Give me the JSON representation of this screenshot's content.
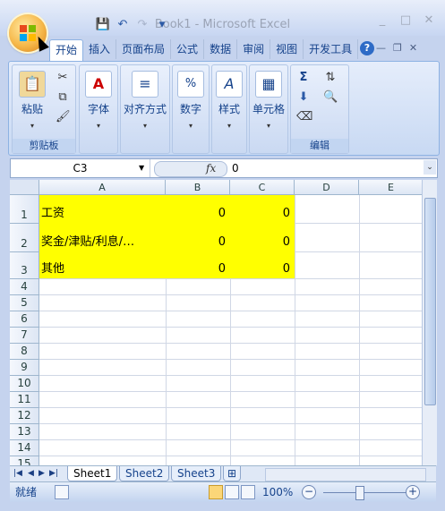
{
  "window": {
    "title": "Book1 - Microsoft Excel"
  },
  "qat": {
    "save": "💾",
    "undo": "↶",
    "redo": "↷",
    "more": "▾"
  },
  "ribbon": {
    "tabs": [
      "开始",
      "插入",
      "页面布局",
      "公式",
      "数据",
      "审阅",
      "视图",
      "开发工具"
    ],
    "groups": {
      "clipboard": {
        "paste": "粘贴",
        "label": "剪贴板"
      },
      "font": {
        "label": "字体"
      },
      "align": {
        "label": "对齐方式"
      },
      "number": {
        "label": "数字"
      },
      "styles": {
        "label": "样式"
      },
      "cells": {
        "label": "单元格"
      },
      "editing": {
        "label": "编辑"
      }
    }
  },
  "formula_bar": {
    "name_box": "C3",
    "fx": "fx",
    "value": "0"
  },
  "sheet": {
    "columns": [
      "A",
      "B",
      "C",
      "D",
      "E"
    ],
    "rows": [
      "1",
      "2",
      "3",
      "4",
      "5",
      "6",
      "7",
      "8",
      "9",
      "10",
      "11",
      "12",
      "13",
      "14",
      "15"
    ],
    "data": [
      {
        "a": "工资",
        "b": "0",
        "c": "0"
      },
      {
        "a": "奖金/津贴/利息/…",
        "b": "0",
        "c": "0"
      },
      {
        "a": "其他",
        "b": "0",
        "c": "0"
      }
    ],
    "highlight_color": "#ffff00"
  },
  "sheet_tabs": [
    "Sheet1",
    "Sheet2",
    "Sheet3"
  ],
  "status": {
    "ready": "就绪",
    "zoom": "100%"
  }
}
